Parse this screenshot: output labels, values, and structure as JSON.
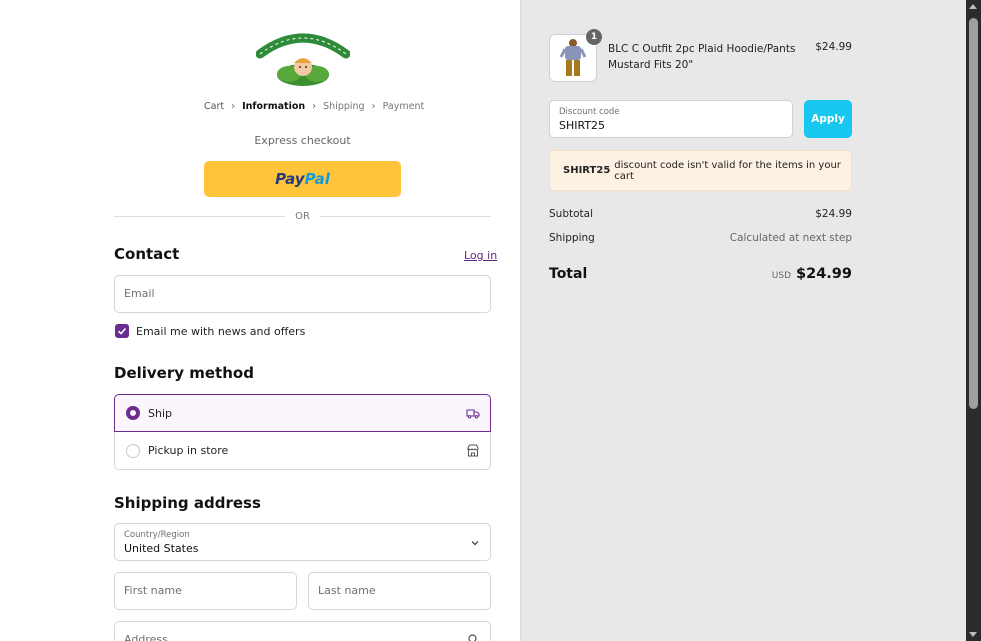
{
  "brand": {
    "logo_text": "Cabbage Patch Kids",
    "accent": "#6b2c8f"
  },
  "breadcrumb": {
    "items": [
      "Cart",
      "Information",
      "Shipping",
      "Payment"
    ],
    "current": "Information"
  },
  "express": {
    "label": "Express checkout",
    "paypal_part1": "Pay",
    "paypal_part2": "Pal",
    "or": "OR"
  },
  "contact": {
    "heading": "Contact",
    "login": "Log in",
    "email_placeholder": "Email",
    "newsletter_label": "Email me with news and offers",
    "newsletter_checked": true
  },
  "delivery": {
    "heading": "Delivery method",
    "options": [
      {
        "label": "Ship",
        "selected": true,
        "icon": "truck-icon"
      },
      {
        "label": "Pickup in store",
        "selected": false,
        "icon": "store-icon"
      }
    ]
  },
  "shipping": {
    "heading": "Shipping address",
    "country_label": "Country/Region",
    "country_value": "United States",
    "first_name_placeholder": "First name",
    "last_name_placeholder": "Last name",
    "address_placeholder": "Address"
  },
  "summary": {
    "product": {
      "name": "BLC C Outfit 2pc Plaid Hoodie/Pants Mustard Fits 20\"",
      "price": "$24.99",
      "quantity": "1"
    },
    "discount": {
      "label": "Discount code",
      "value": "SHIRT25",
      "apply": "Apply"
    },
    "notice": {
      "code": "SHIRT25",
      "message": "discount code isn't valid for the items in your cart"
    },
    "subtotal_label": "Subtotal",
    "subtotal_value": "$24.99",
    "shipping_label": "Shipping",
    "shipping_value": "Calculated at next step",
    "total_label": "Total",
    "currency": "USD",
    "total_value": "$24.99"
  },
  "colors": {
    "paypal_yellow": "#ffc439",
    "apply_button": "#17c7ef",
    "notice_bg": "#fdf1e4",
    "summary_bg": "#e8e8e8"
  }
}
